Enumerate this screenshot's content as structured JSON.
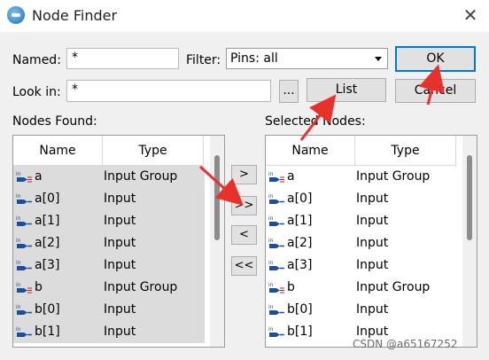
{
  "window": {
    "title": "Node Finder",
    "close_glyph": "✕"
  },
  "named": {
    "label": "Named:",
    "value": "*"
  },
  "filter": {
    "label": "Filter:",
    "value": "Pins: all"
  },
  "look_in": {
    "label": "Look in:",
    "value": "*",
    "browse_label": "..."
  },
  "buttons": {
    "ok": "OK",
    "list": "List",
    "cancel": "Cancel"
  },
  "nodes_found": {
    "label": "Nodes Found:",
    "columns": [
      "Name",
      "Type"
    ],
    "rows": [
      {
        "icon": "input-group-pin-icon",
        "name": "a",
        "type": "Input Group"
      },
      {
        "icon": "input-pin-icon",
        "name": "a[0]",
        "type": "Input"
      },
      {
        "icon": "input-pin-icon",
        "name": "a[1]",
        "type": "Input"
      },
      {
        "icon": "input-pin-icon",
        "name": "a[2]",
        "type": "Input"
      },
      {
        "icon": "input-pin-icon",
        "name": "a[3]",
        "type": "Input"
      },
      {
        "icon": "input-group-pin-icon",
        "name": "b",
        "type": "Input Group"
      },
      {
        "icon": "input-pin-icon",
        "name": "b[0]",
        "type": "Input"
      },
      {
        "icon": "input-pin-icon",
        "name": "b[1]",
        "type": "Input"
      }
    ]
  },
  "transfer": {
    "add": ">",
    "add_all": ">>",
    "remove": "<",
    "remove_all": "<<"
  },
  "selected_nodes": {
    "label": "Selected Nodes:",
    "columns": [
      "Name",
      "Type"
    ],
    "rows": [
      {
        "icon": "input-group-pin-icon",
        "name": "a",
        "type": "Input Group"
      },
      {
        "icon": "input-pin-icon",
        "name": "a[0]",
        "type": "Input"
      },
      {
        "icon": "input-pin-icon",
        "name": "a[1]",
        "type": "Input"
      },
      {
        "icon": "input-pin-icon",
        "name": "a[2]",
        "type": "Input"
      },
      {
        "icon": "input-pin-icon",
        "name": "a[3]",
        "type": "Input"
      },
      {
        "icon": "input-group-pin-icon",
        "name": "b",
        "type": "Input Group"
      },
      {
        "icon": "input-pin-icon",
        "name": "b[0]",
        "type": "Input"
      },
      {
        "icon": "input-pin-icon",
        "name": "b[1]",
        "type": "Input"
      }
    ]
  },
  "watermark": "CSDN @a65167252",
  "colors": {
    "accent": "#0078d7",
    "annotation": "#e8312a",
    "selection": "#dcdcdc"
  }
}
